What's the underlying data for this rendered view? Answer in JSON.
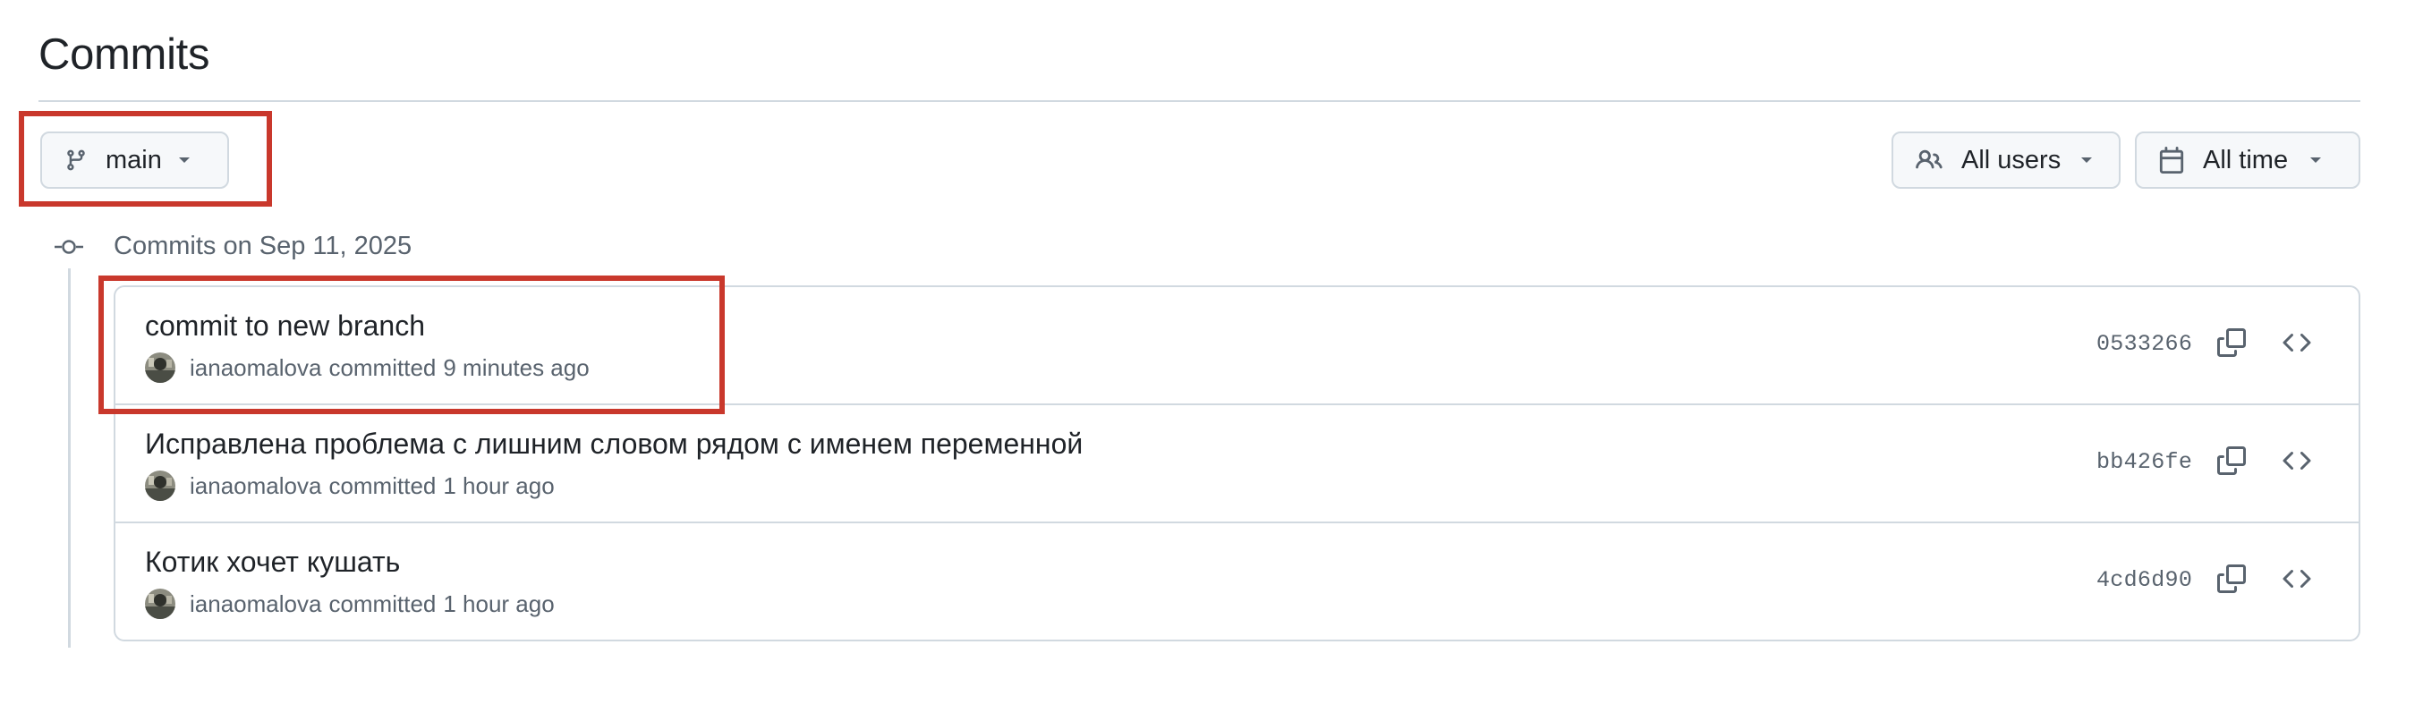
{
  "header": {
    "title": "Commits"
  },
  "toolbar": {
    "branch": {
      "label": "main",
      "icon": "git-branch-icon"
    },
    "users_filter": {
      "label": "All users",
      "icon": "people-icon"
    },
    "time_filter": {
      "label": "All time",
      "icon": "calendar-icon"
    }
  },
  "commit_groups": [
    {
      "label": "Commits on Sep 11, 2025",
      "commits": [
        {
          "title": "commit to new branch",
          "author": "ianaomalova",
          "action": "committed",
          "time": "9 minutes ago",
          "sha": "0533266"
        },
        {
          "title": "Исправлена проблема с лишним словом рядом с именем переменной",
          "author": "ianaomalova",
          "action": "committed",
          "time": "1 hour ago",
          "sha": "bb426fe"
        },
        {
          "title": "Котик хочет кушать",
          "author": "ianaomalova",
          "action": "committed",
          "time": "1 hour ago",
          "sha": "4cd6d90"
        }
      ]
    }
  ],
  "colors": {
    "annotation": "#c9382c",
    "border": "#d1d9e0",
    "muted_text": "#59636e",
    "primary_text": "#1f2328",
    "button_bg": "#f6f8fa"
  }
}
